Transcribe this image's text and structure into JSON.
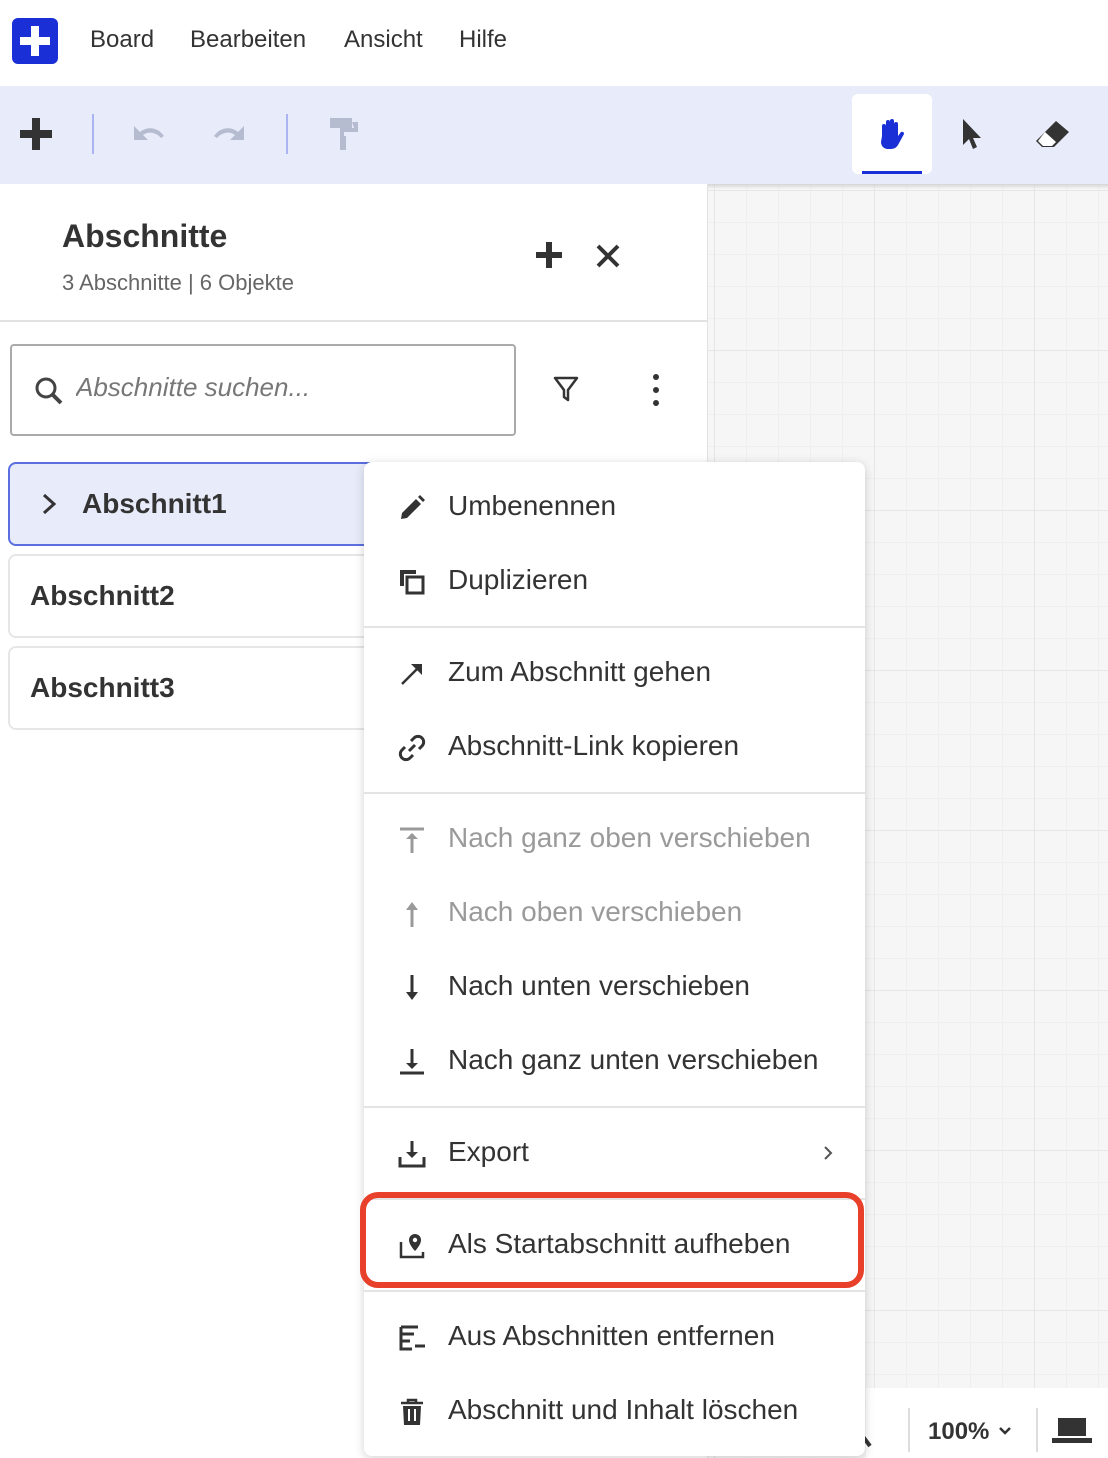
{
  "menubar": {
    "items": [
      "Board",
      "Bearbeiten",
      "Ansicht",
      "Hilfe"
    ]
  },
  "toolbar": {
    "tools": [
      "add-icon",
      "undo-icon",
      "redo-icon",
      "format-painter-icon",
      "hand-icon",
      "pointer-icon",
      "eraser-icon"
    ],
    "active_tool": "hand-icon",
    "accent_color": "#1a2fd6"
  },
  "panel": {
    "title": "Abschnitte",
    "subtitle": "3 Abschnitte | 6 Objekte",
    "search": {
      "placeholder": "Abschnitte suchen..."
    },
    "sections": [
      {
        "label": "Abschnitt1",
        "active": true
      },
      {
        "label": "Abschnitt2",
        "active": false
      },
      {
        "label": "Abschnitt3",
        "active": false
      }
    ]
  },
  "context_menu": {
    "items": [
      {
        "label": "Umbenennen",
        "icon": "pencil-icon",
        "disabled": false
      },
      {
        "label": "Duplizieren",
        "icon": "duplicate-icon",
        "disabled": false
      },
      {
        "label": "Zum Abschnitt gehen",
        "icon": "arrow-up-right-icon",
        "disabled": false
      },
      {
        "label": "Abschnitt-Link kopieren",
        "icon": "link-icon",
        "disabled": false
      },
      {
        "label": "Nach ganz oben verschieben",
        "icon": "move-top-icon",
        "disabled": true
      },
      {
        "label": "Nach oben verschieben",
        "icon": "move-up-icon",
        "disabled": true
      },
      {
        "label": "Nach unten verschieben",
        "icon": "move-down-icon",
        "disabled": false
      },
      {
        "label": "Nach ganz unten verschieben",
        "icon": "move-bottom-icon",
        "disabled": false
      },
      {
        "label": "Export",
        "icon": "export-icon",
        "disabled": false,
        "submenu": true
      },
      {
        "label": "Als Startabschnitt aufheben",
        "icon": "start-section-icon",
        "disabled": false,
        "highlighted": true
      },
      {
        "label": "Aus Abschnitten entfernen",
        "icon": "remove-from-sections-icon",
        "disabled": false
      },
      {
        "label": "Abschnitt und Inhalt löschen",
        "icon": "trash-icon",
        "disabled": false
      }
    ],
    "highlight_color": "#e8402a"
  },
  "status": {
    "zoom": "100%"
  }
}
